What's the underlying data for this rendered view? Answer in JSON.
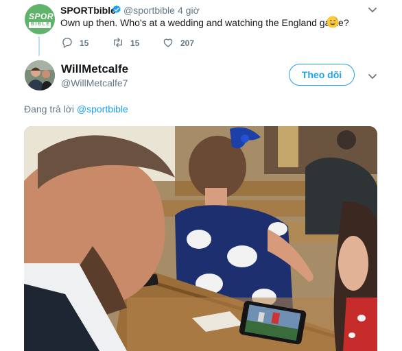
{
  "tweet_parent": {
    "display_name": "SPORTbible",
    "handle": "@sportbible",
    "separator": "·",
    "time": "4 giờ",
    "text": "Own up then. Who's at a wedding and watching the England game?",
    "avatar_text_top": "SPORT",
    "avatar_text_bottom": "BIBLE",
    "actions": {
      "replies": "15",
      "retweets": "15",
      "likes": "207"
    }
  },
  "tweet_reply": {
    "display_name": "WillMetcalfe",
    "handle": "@WillMetcalfe7",
    "follow_label": "Theo dõi",
    "replying_prefix": "Đang trả lời",
    "replying_mention": "@sportbible"
  },
  "colors": {
    "accent": "#1da1f2",
    "muted": "#657786",
    "sportbible_green": "#5fb36a"
  },
  "icons": [
    "verified-badge-icon",
    "chevron-down-icon",
    "reply-icon",
    "retweet-icon",
    "like-icon",
    "grinning-sweat-emoji"
  ]
}
